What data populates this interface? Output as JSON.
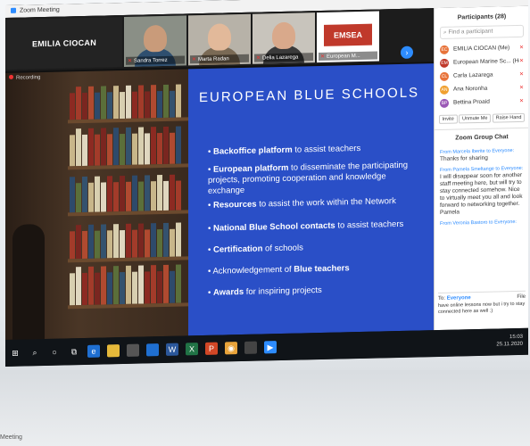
{
  "window": {
    "title": "Zoom Meeting"
  },
  "recording": "Recording",
  "tiles": [
    {
      "name": "EMILIA CIOCAN",
      "type": "name"
    },
    {
      "name": "Sandra Torrez",
      "type": "cam",
      "skin": "#c99b7a",
      "shirt": "#2f4f6f"
    },
    {
      "name": "Marta Radan",
      "type": "cam",
      "skin": "#e2b99a",
      "shirt": "#7a6a55"
    },
    {
      "name": "Delia Lazarega",
      "type": "cam",
      "skin": "#d9a98b",
      "shirt": "#3a3a3a"
    },
    {
      "name": "European M...",
      "type": "logo",
      "logo_text": "EMSEA"
    }
  ],
  "slide": {
    "title": "EUROPEAN BLUE SCHOOLS",
    "bullets": [
      {
        "bold": "Backoffice platform",
        "rest": " to assist teachers"
      },
      {
        "bold": "European platform",
        "rest": " to disseminate the participating projects, promoting cooperation and knowledge exchange"
      },
      {
        "bold": "Resources",
        "rest": " to assist the work within the Network"
      },
      {
        "bold": "National Blue School contacts",
        "rest": " to assist teachers"
      },
      {
        "bold": "Certification",
        "rest": " of schools"
      },
      {
        "pre": "Acknowledgement of ",
        "bold": "Blue teachers",
        "rest": ""
      },
      {
        "bold": "Awards",
        "rest": " for inspiring projects"
      }
    ]
  },
  "participants": {
    "header": "Participants (28)",
    "search_placeholder": "Find a participant",
    "list": [
      {
        "initials": "EC",
        "name": "EMILIA CIOCAN (Me)",
        "color": "#e8733a"
      },
      {
        "initials": "EM",
        "name": "European Marine Sc... (Host)",
        "color": "#c0392b"
      },
      {
        "initials": "CL",
        "name": "Carla Lazarega",
        "color": "#e8733a"
      },
      {
        "initials": "AN",
        "name": "Ana Noronha",
        "color": "#f0a030"
      },
      {
        "initials": "BP",
        "name": "Bettina Proaid",
        "color": "#9b59b6"
      }
    ],
    "buttons": [
      "Invite",
      "Unmute Me",
      "Raise Hand"
    ]
  },
  "chat": {
    "header": "Zoom Group Chat",
    "messages": [
      {
        "from": "From Marcela Iberite to Everyone:",
        "text": "Thanks for sharing"
      },
      {
        "from": "From Pamela Smeltange to Everyone:",
        "text": "I will disappear soon for another staff meeting here, but will try to stay connected somehow. Nice to virtually meet you all and look forward to networking together. Pamela"
      },
      {
        "from": "From Veronia Bastoro to Everyone:",
        "text": ""
      }
    ],
    "to_label": "To:",
    "to_value": "Everyone",
    "file_label": "File",
    "draft": "have online lessons now but i try to stay connected here as well :)"
  },
  "tray": {
    "time": "15:03",
    "date": "25.11.2020"
  },
  "footer_text": "Meeting"
}
